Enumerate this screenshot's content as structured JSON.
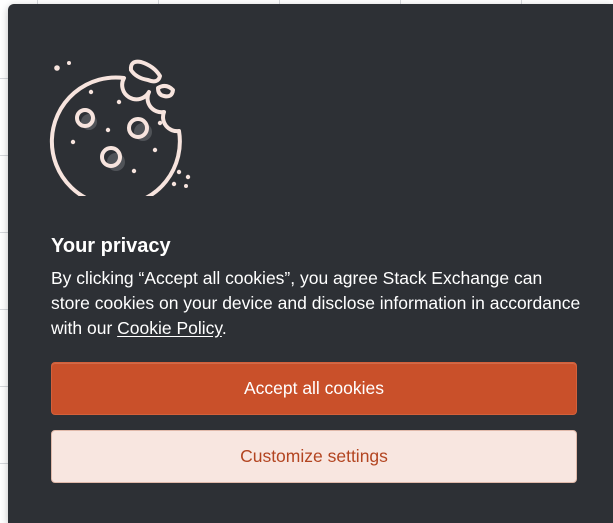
{
  "banner": {
    "title": "Your privacy",
    "body_prefix": "By clicking “Accept all cookies”, you agree Stack Exchange can store cookies on your device and disclose information in accordance with our ",
    "policy_link": "Cookie Policy",
    "body_suffix": ".",
    "accept_label": "Accept all cookies",
    "customize_label": "Customize settings"
  },
  "icons": {
    "cookie": "cookie-icon"
  },
  "colors": {
    "banner_bg": "#2d3035",
    "accent": "#c9502a",
    "secondary_bg": "#f8e6e0",
    "secondary_text": "#b34521",
    "icon_stroke": "#f7e4de"
  }
}
